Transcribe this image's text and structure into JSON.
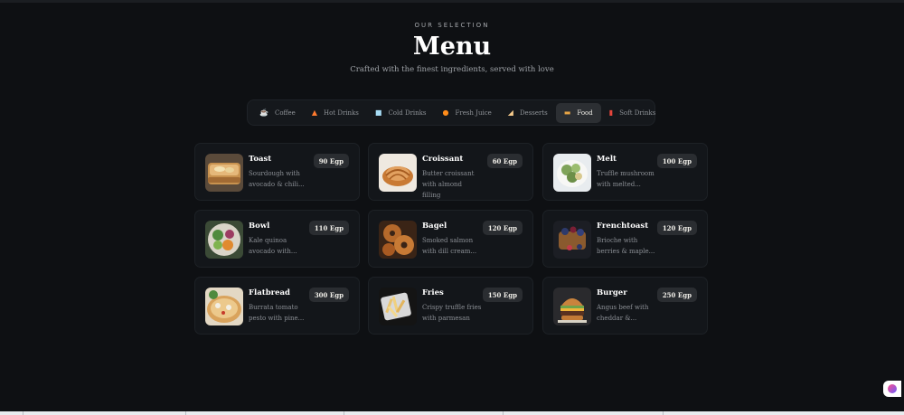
{
  "header": {
    "eyebrow": "OUR SELECTION",
    "title": "Menu",
    "subtitle": "Crafted with the finest ingredients, served with love"
  },
  "tabs": [
    {
      "label": "Coffee",
      "icon": "coffee-icon",
      "active": false
    },
    {
      "label": "Hot Drinks",
      "icon": "fire-icon",
      "active": false
    },
    {
      "label": "Cold Drinks",
      "icon": "ice-cube-icon",
      "active": false
    },
    {
      "label": "Fresh Juice",
      "icon": "orange-icon",
      "active": false
    },
    {
      "label": "Desserts",
      "icon": "cake-icon",
      "active": false
    },
    {
      "label": "Food",
      "icon": "burger-icon",
      "active": true
    },
    {
      "label": "Soft Drinks",
      "icon": "soda-cup-icon",
      "active": false
    }
  ],
  "items": [
    {
      "name": "Toast",
      "desc": "Sourdough with avocado & chili...",
      "price": "90 Egp",
      "image": "toast-image"
    },
    {
      "name": "Croissant",
      "desc": "Butter croissant with almond filling",
      "price": "60 Egp",
      "image": "croissant-image"
    },
    {
      "name": "Melt",
      "desc": "Truffle mushroom with melted...",
      "price": "100 Egp",
      "image": "melt-image"
    },
    {
      "name": "Bowl",
      "desc": "Kale quinoa avocado with...",
      "price": "110 Egp",
      "image": "bowl-image"
    },
    {
      "name": "Bagel",
      "desc": "Smoked salmon with dill cream...",
      "price": "120 Egp",
      "image": "bagel-image"
    },
    {
      "name": "Frenchtoast",
      "desc": "Brioche with berries & maple...",
      "price": "120 Egp",
      "image": "frenchtoast-image"
    },
    {
      "name": "Flatbread",
      "desc": "Burrata tomato pesto with pine...",
      "price": "300 Egp",
      "image": "flatbread-image"
    },
    {
      "name": "Fries",
      "desc": "Crispy truffle fries with parmesan",
      "price": "150 Egp",
      "image": "fries-image"
    },
    {
      "name": "Burger",
      "desc": "Angus beef with cheddar &...",
      "price": "250 Egp",
      "image": "burger-image"
    }
  ],
  "colors": {
    "background": "#0e1013",
    "card": "#13161a",
    "active_tab": "#2c2f33",
    "price_badge": "#2a2d31"
  }
}
